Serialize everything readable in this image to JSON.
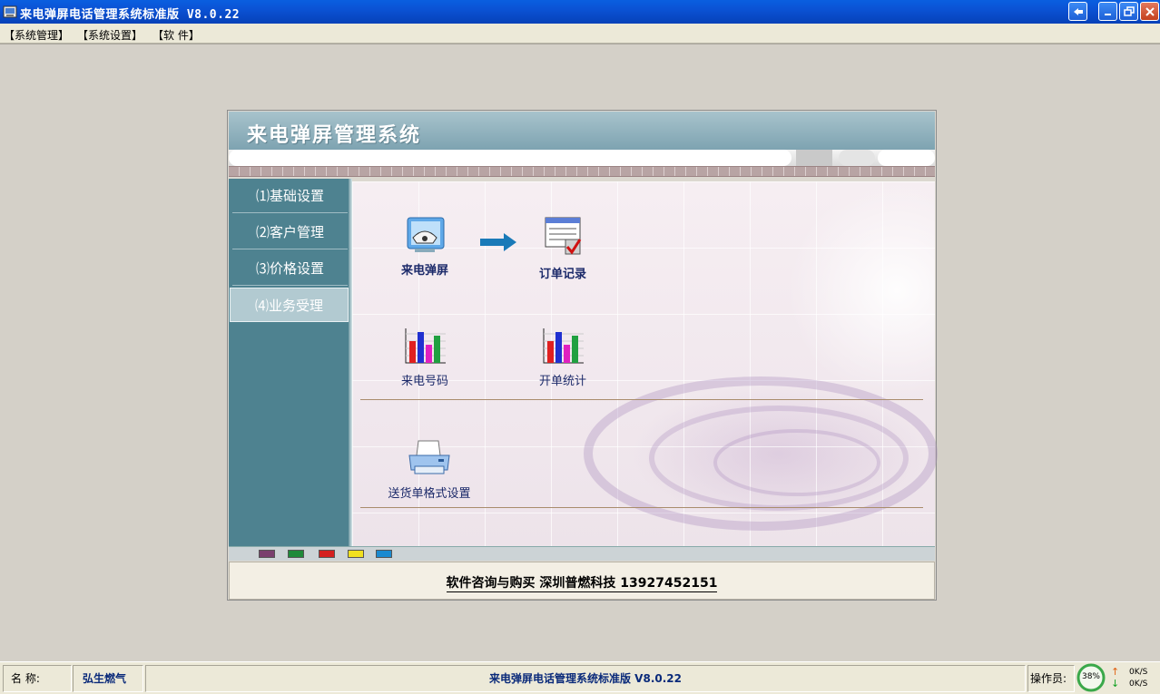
{
  "window": {
    "title": "来电弹屏电话管理系统标准版  V8.0.22"
  },
  "menu": {
    "items": [
      "【系统管理】",
      "【系统设置】",
      "【软  件】"
    ]
  },
  "panel": {
    "banner_title": "来电弹屏管理系统",
    "sidebar": [
      {
        "label": "⑴基础设置"
      },
      {
        "label": "⑵客户管理"
      },
      {
        "label": "⑶价格设置"
      },
      {
        "label": "⑷业务受理",
        "active": true
      }
    ],
    "tiles": {
      "caller_popup": "来电弹屏",
      "order_records": "订单记录",
      "caller_numbers": "来电号码",
      "order_stats": "开单统计",
      "delivery_format": "送货单格式设置"
    },
    "swatches": [
      "#7a3f6e",
      "#1f8a3a",
      "#d42020",
      "#f0e020",
      "#1a8ad0"
    ],
    "footer_text": "软件咨询与购买   深圳普燃科技 13927452151"
  },
  "status": {
    "name_label": "名    称:",
    "name_value": "弘生燃气",
    "center_title": "来电弹屏电话管理系统标准版  V8.0.22",
    "operator_label": "操作员:",
    "cpu_percent": "38%",
    "up_speed": "0K/S",
    "down_speed": "0K/S"
  },
  "colors": {
    "titlebar": "#0b52d4",
    "sidebar": "#4e8290",
    "banner": "#8fb1bd"
  }
}
